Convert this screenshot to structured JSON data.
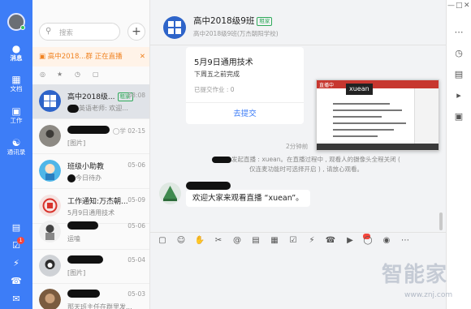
{
  "nav": {
    "items": [
      {
        "label": "消息",
        "icon": "chat-bubble-icon"
      },
      {
        "label": "文档",
        "icon": "document-icon"
      },
      {
        "label": "工作",
        "icon": "apps-grid-icon"
      },
      {
        "label": "通讯录",
        "icon": "contacts-icon"
      }
    ],
    "bottom_badge": "1"
  },
  "session_list": {
    "search_placeholder": "搜索",
    "live_banner": "高中2018...群 正在直播",
    "sessions": [
      {
        "name": "高中2018级...",
        "tag": "租家",
        "time": "08:08",
        "preview": "英语老师: 欢迎..."
      },
      {
        "name": "",
        "tag": "",
        "time": "02-15",
        "preview": "[图片]",
        "time_prefix": "学"
      },
      {
        "name": "班级小助教",
        "tag": "",
        "time": "05-06",
        "preview": "今日待办"
      },
      {
        "name": "工作通知:万杰朝...",
        "tag": "",
        "time": "05-09",
        "preview": "5月9日通用技术"
      },
      {
        "name": "",
        "tag": "",
        "time": "05-06",
        "preview": "运嗑"
      },
      {
        "name": "",
        "tag": "",
        "time": "05-04",
        "preview": "[图片]"
      },
      {
        "name": "",
        "tag": "",
        "time": "05-03",
        "preview": "那天班主任在群里发..."
      }
    ]
  },
  "chat": {
    "title": "高中2018级9班",
    "title_tag": "租家",
    "subtitle": "高中2018级9班(万杰朝阳学校)",
    "card": {
      "title": "5月9日通用技术",
      "desc": "下周五之前完成",
      "count": "已提交作业 : 0",
      "submit": "去提交"
    },
    "video": {
      "live_label": "直播中",
      "name": "xuean"
    },
    "timestamp": "2分钟前",
    "system_message": "发起直播 : xuean。在直播过程中 , 观看人的摄像头全程关闭 ( 仅连麦功能时可选择开启 ) , 请放心观看。",
    "bubble": "欢迎大家来观看直播 “xuean”。"
  },
  "watermark": {
    "text": "智能家",
    "url": "www.znj.com"
  }
}
